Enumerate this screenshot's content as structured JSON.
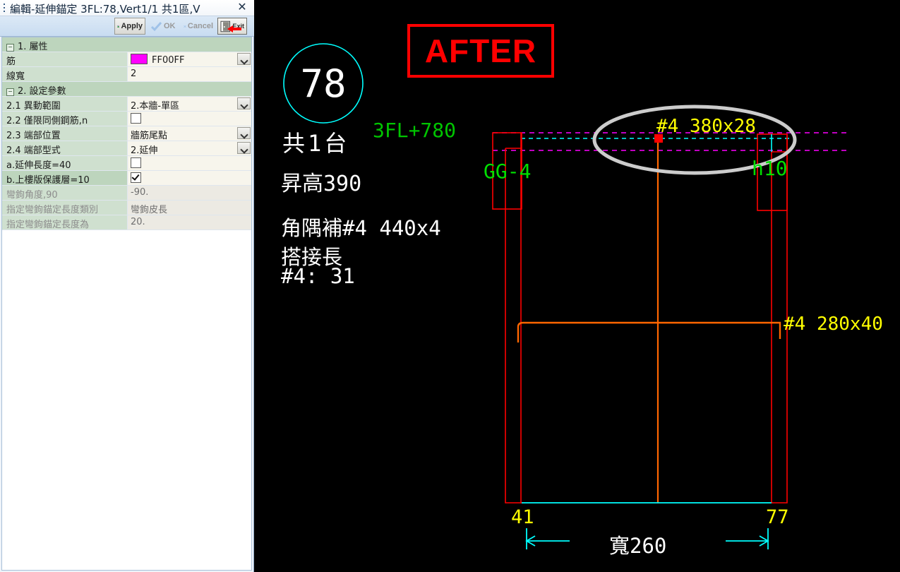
{
  "window": {
    "title": "編輯-延伸錨定 3FL:78,Vert1/1 共1區,V",
    "close_icon": "close-icon",
    "grip_icon": "drag-grip-icon"
  },
  "toolbar": {
    "apply_label": "Apply",
    "ok_label": "OK",
    "cancel_label": "Cancel",
    "exit_label": "Exit"
  },
  "grid": {
    "categories": [
      {
        "label": "1. 屬性",
        "rows": [
          {
            "key": "筋",
            "value": "FF00FF",
            "type": "color",
            "color": "#ff00ff",
            "dropdown": true,
            "selected": false
          },
          {
            "key": "線寬",
            "value": "2",
            "type": "text",
            "dropdown": false,
            "selected": false
          }
        ]
      },
      {
        "label": "2. 設定參數",
        "rows": [
          {
            "key": "2.1 異動範圍",
            "value": "2.本牆-單區",
            "type": "text",
            "dropdown": true,
            "selected": false
          },
          {
            "key": "2.2 僅限同側鋼筋,n",
            "value": "",
            "type": "checkbox",
            "checked": false,
            "dropdown": false,
            "selected": false
          },
          {
            "key": "2.3 端部位置",
            "value": "牆筋尾點",
            "type": "text",
            "dropdown": true,
            "selected": false
          },
          {
            "key": "2.4 端部型式",
            "value": "2.延伸",
            "type": "text",
            "dropdown": true,
            "selected": false
          },
          {
            "key": "a.延伸長度=40",
            "value": "",
            "type": "checkbox",
            "checked": false,
            "dropdown": false,
            "selected": false
          },
          {
            "key": "b.上樓版保護層=10",
            "value": "",
            "type": "checkbox",
            "checked": true,
            "dropdown": false,
            "selected": true
          },
          {
            "key": "彎鉤角度,90",
            "value": "-90.",
            "type": "text",
            "dropdown": false,
            "dim": true
          },
          {
            "key": "指定彎鉤錨定長度類別",
            "value": "彎鉤皮長",
            "type": "text",
            "dropdown": false,
            "dim": true
          },
          {
            "key": "指定彎鉤錨定長度為",
            "value": "20.",
            "type": "text",
            "dropdown": false,
            "dim": true
          }
        ]
      }
    ]
  },
  "cad": {
    "after_badge": "AFTER",
    "bubble_number": "78",
    "labels": {
      "count": "共1台",
      "rise": "昇高390",
      "corner_bar": "角隅補#4  440x4",
      "lap_title": "搭接長",
      "lap_value": "#4:  31",
      "level": "3FL+780",
      "left_col": "GG-4",
      "right_col": "h10",
      "top_bar": "#4  380x28",
      "side_bar": "#4  280x40",
      "dim_left": "41",
      "dim_right": "77",
      "dim_width": "寬260"
    },
    "colors": {
      "background": "#000000",
      "wall": "#ff0000",
      "rebar": "#ff6600",
      "annotation": "#ffff00",
      "level_text": "#00ff00",
      "dimension": "#00ffff",
      "magenta_line": "#ff00ff",
      "highlight_ellipse": "#cccccc",
      "text": "#ffffff",
      "after_badge": "#ff0000"
    }
  }
}
